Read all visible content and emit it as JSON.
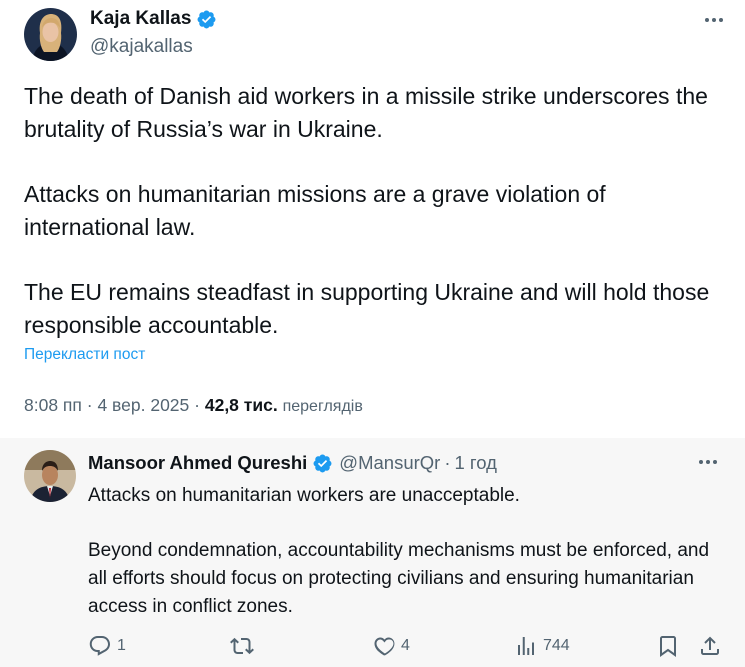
{
  "main_tweet": {
    "author_name": "Kaja Kallas",
    "author_handle": "@kajakallas",
    "paragraphs": [
      "The death of Danish aid workers in a missile strike underscores the brutality of Russia’s war in Ukraine.",
      "Attacks on humanitarian missions are a grave violation of international law.",
      "The EU remains steadfast in supporting Ukraine and will hold those responsible accountable."
    ],
    "translate_label": "Перекласти пост",
    "time": "8:08 пп",
    "separator": "·",
    "date": "4 вер. 2025",
    "views_count": "42,8 тис.",
    "views_label": "переглядів"
  },
  "reply": {
    "author_name": "Mansoor Ahmed Qureshi",
    "author_handle": "@MansurQr",
    "separator": "·",
    "time_ago": "1 год",
    "paragraphs": [
      "Attacks on humanitarian workers are unacceptable.",
      "Beyond condemnation, accountability mechanisms must be enforced, and all efforts should focus on protecting civilians and ensuring humanitarian access in conflict zones."
    ],
    "actions": {
      "reply_count": "1",
      "repost_count": "",
      "like_count": "4",
      "views_count": "744"
    }
  },
  "colors": {
    "verified_blue": "#1d9bf0",
    "link_blue": "#1d9bf0",
    "secondary_text": "#536471",
    "reply_background": "#f7f7f7"
  },
  "icons": [
    "verified-badge-icon",
    "more-icon",
    "reply-icon",
    "repost-icon",
    "like-icon",
    "views-icon",
    "bookmark-icon",
    "share-icon"
  ]
}
